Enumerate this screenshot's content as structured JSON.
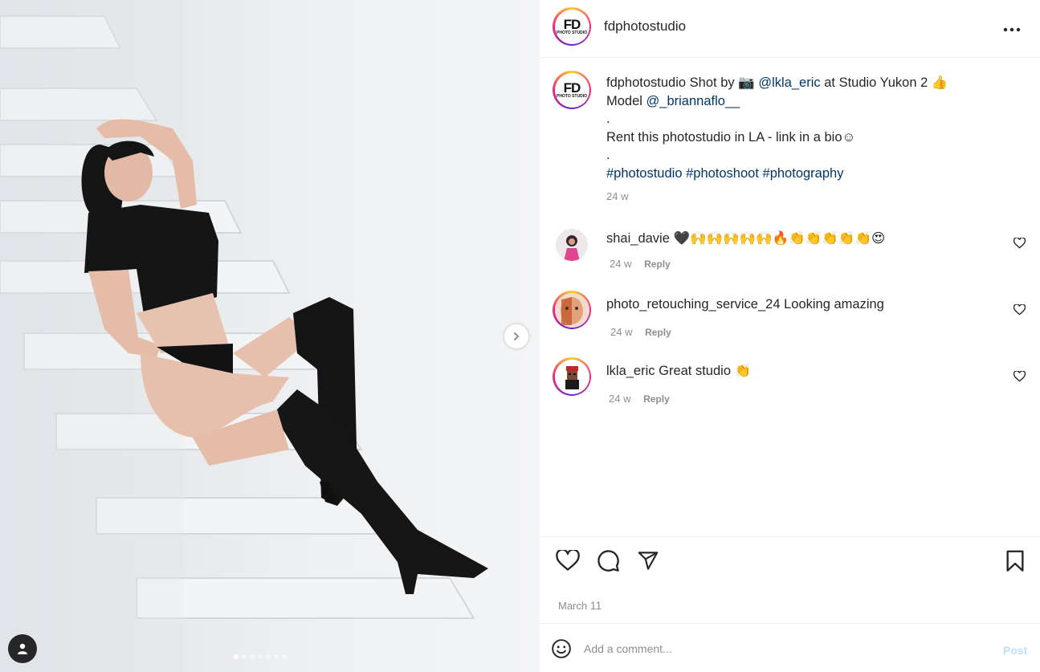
{
  "post": {
    "username": "fdphotostudio",
    "avatar_logo": {
      "big": "FD",
      "small": "PHOTO STUDIO"
    },
    "more_icon": "more-horizontal-icon"
  },
  "caption": {
    "username": "fdphotostudio",
    "line1_text": " Shot by ",
    "camera_emoji": "📷",
    "photographer": "@lkla_eric",
    "line1_after": " at Studio Yukon 2 ",
    "thumbs_emoji": "👍",
    "model_label": "Model ",
    "model_handle": "@_briannaflo__",
    "dot1": ".",
    "rent_text": "Rent this photostudio in LA - link in a bio",
    "smile_emoji": "☺",
    "dot2": ".",
    "hashtags": [
      "#photostudio",
      "#photoshoot",
      "#photography"
    ],
    "time": "24 w"
  },
  "comments": [
    {
      "username": "shai_davie",
      "text": "🖤🙌🙌🙌🙌🙌🔥👏👏👏👏👏😍",
      "time": "24 w",
      "reply": "Reply"
    },
    {
      "username": "photo_retouching_service_24",
      "text": "Looking amazing",
      "time": "24 w",
      "reply": "Reply"
    },
    {
      "username": "lkla_eric",
      "text": "Great studio 👏",
      "time": "24 w",
      "reply": "Reply"
    }
  ],
  "actions": {
    "like_icon": "heart-icon",
    "comment_icon": "comment-bubble-icon",
    "share_icon": "paper-plane-icon",
    "save_icon": "bookmark-icon"
  },
  "date": {
    "month": "March",
    "day": "11"
  },
  "composer": {
    "placeholder": "Add a comment...",
    "post_label": "Post"
  },
  "carousel": {
    "slide_count": 7,
    "active_index": 0
  },
  "colors": {
    "link": "#00376b",
    "muted": "#8e8e8e",
    "post_disabled": "#c0dffd"
  }
}
